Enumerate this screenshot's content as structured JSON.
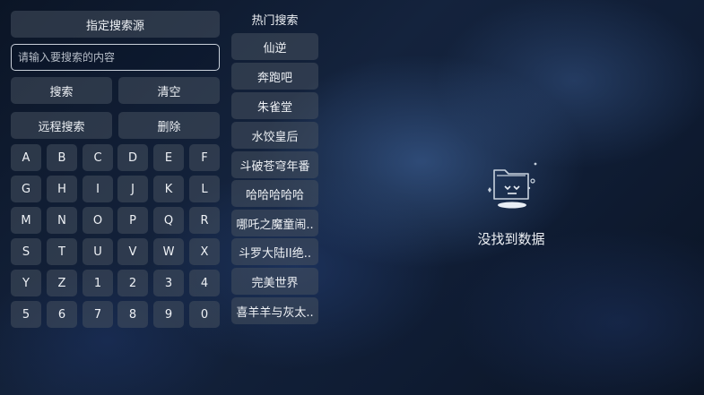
{
  "search": {
    "source_button": "指定搜索源",
    "placeholder": "请输入要搜索的内容",
    "search_button": "搜索",
    "clear_button": "清空",
    "remote_button": "远程搜索",
    "delete_button": "删除"
  },
  "keyboard": {
    "rows": [
      [
        "A",
        "B",
        "C",
        "D",
        "E",
        "F"
      ],
      [
        "G",
        "H",
        "I",
        "J",
        "K",
        "L"
      ],
      [
        "M",
        "N",
        "O",
        "P",
        "Q",
        "R"
      ],
      [
        "S",
        "T",
        "U",
        "V",
        "W",
        "X"
      ],
      [
        "Y",
        "Z",
        "1",
        "2",
        "3",
        "4"
      ],
      [
        "5",
        "6",
        "7",
        "8",
        "9",
        "0"
      ]
    ]
  },
  "hot": {
    "title": "热门搜索",
    "items": [
      "仙逆",
      "奔跑吧",
      "朱雀堂",
      "水饺皇后",
      "斗破苍穹年番",
      "哈哈哈哈哈",
      "哪吒之魔童闹..",
      "斗罗大陆II绝..",
      "完美世界",
      "喜羊羊与灰太.."
    ]
  },
  "results": {
    "empty_text": "没找到数据",
    "icon": "empty-folder-icon"
  }
}
